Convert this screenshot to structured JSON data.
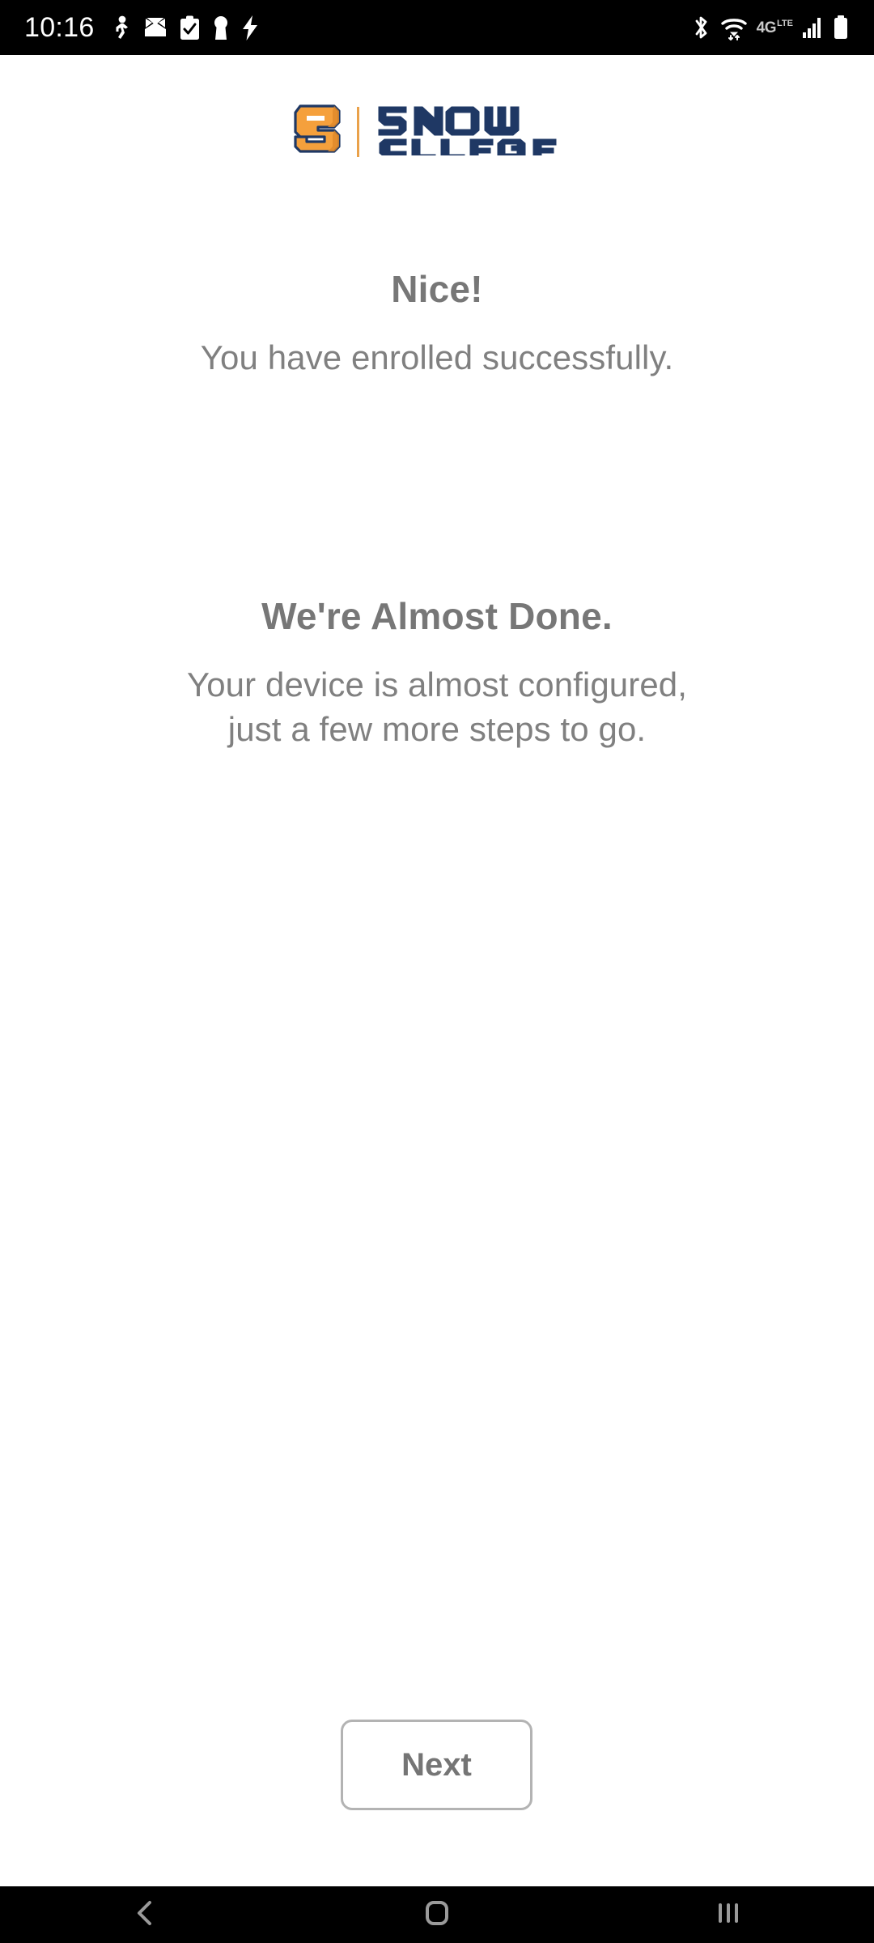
{
  "status_bar": {
    "clock": "10:16",
    "battery_percent": "91%",
    "network_type": "4G",
    "network_sub": "LTE",
    "left_icons": [
      "running-person-icon",
      "email-open-icon",
      "clipboard-check-icon",
      "vpn-key-icon",
      "charging-bolt-icon"
    ],
    "right_icons": [
      "bluetooth-icon",
      "wifi-icon",
      "signal-bars-icon",
      "battery-icon"
    ]
  },
  "brand": {
    "mark_letter": "S",
    "name_line1": "SNOW",
    "name_line2": "COLLEGE",
    "orange": "#F5A03C",
    "navy": "#1F3864",
    "divider_color": "#EAA14A"
  },
  "main": {
    "headline_primary": "Nice!",
    "subtext_primary": "You have enrolled successfully.",
    "headline_secondary": "We're Almost Done.",
    "subtext_secondary": "Your device is almost configured,\njust a few more steps to go.",
    "text_color": "#808080"
  },
  "footer": {
    "next_label": "Next",
    "button_border_color": "#B3B3B3"
  },
  "nav_bar": {
    "back_icon": "back-chevron-icon",
    "home_icon": "home-square-icon",
    "recents_icon": "recents-bars-icon",
    "icon_color": "#9A9A9A"
  }
}
